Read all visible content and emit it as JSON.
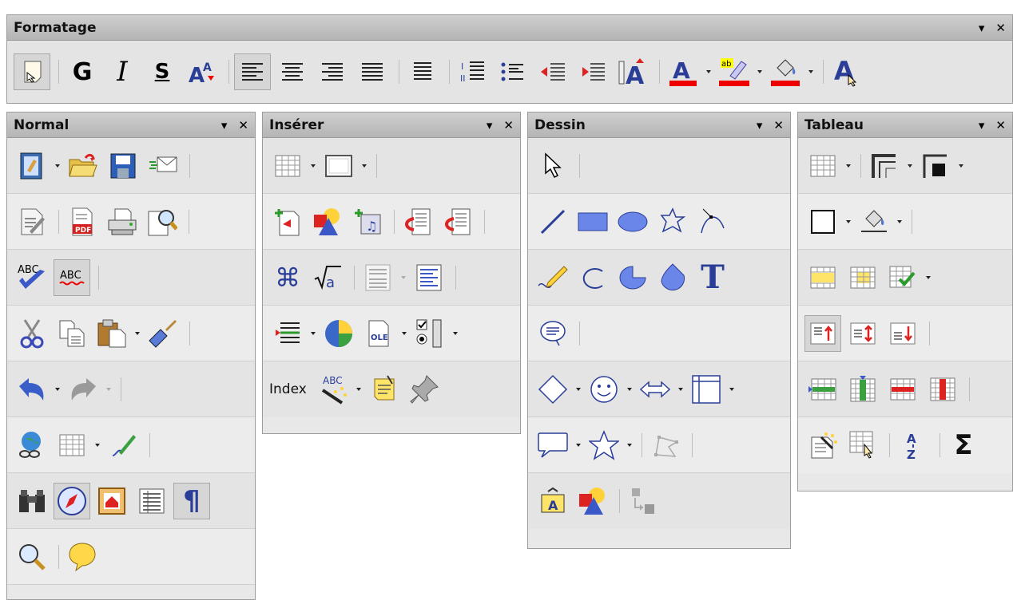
{
  "toolbars": {
    "formatage": {
      "title": "Formatage"
    },
    "normal": {
      "title": "Normal"
    },
    "inserer": {
      "title": "Insérer",
      "index_label": "Index"
    },
    "dessin": {
      "title": "Dessin"
    },
    "tableau": {
      "title": "Tableau"
    }
  },
  "controls": {
    "menu": "▾",
    "close": "✕"
  },
  "formatting_glyphs": {
    "bold": "G",
    "italic": "I",
    "shadow": "S",
    "abc": "ABC",
    "ole": "OLE",
    "index": "Index",
    "question": "?",
    "pilcrow": "¶",
    "sigma": "Σ",
    "t": "T",
    "a": "A"
  }
}
